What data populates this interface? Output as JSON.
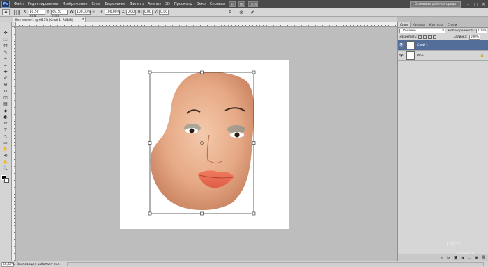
{
  "app": {
    "logo": "Ps",
    "menu": [
      "Файл",
      "Редактирование",
      "Изображение",
      "Слои",
      "Выделение",
      "Фильтр",
      "Анализ",
      "3D",
      "Просмотр",
      "Окно",
      "Справка"
    ],
    "menu_icons": [
      "Br",
      "Mb",
      "100%"
    ],
    "workspace_button": "Основная рабочая среда",
    "window_controls": [
      "–",
      "□",
      "×"
    ]
  },
  "options_bar": {
    "tool_icon": "move-icon",
    "x_label": "X:",
    "x_value": "80,50 mm",
    "y_label": "Y:",
    "y_value": "69,50 mm",
    "w_label": "W:",
    "w_value": "100,00%",
    "h_label": "H:",
    "h_value": "100,00%",
    "angle_label": "∠",
    "angle_value": "0,00",
    "skew_h_label": "H:",
    "skew_h_value": "0,00",
    "skew_v_label": "V:",
    "skew_v_value": "0,00",
    "right_icons": [
      "warp-icon",
      "cancel-icon",
      "commit-icon"
    ]
  },
  "document": {
    "tab_title": "Без имени-1 @ 66,7% (Слой 1, RGB/8)",
    "tab_close": "×",
    "zoom": "66,67%",
    "status": "Экспозиция работает только в"
  },
  "tools": [
    "move-icon",
    "marquee-icon",
    "lasso-icon",
    "quick-select-icon",
    "crop-icon",
    "eyedropper-icon",
    "healing-icon",
    "brush-icon",
    "clone-icon",
    "history-brush-icon",
    "eraser-icon",
    "gradient-icon",
    "blur-icon",
    "dodge-icon",
    "pen-icon",
    "type-icon",
    "path-select-icon",
    "shape-icon",
    "hand-3d-icon",
    "rotate-3d-icon",
    "hand-icon",
    "zoom-icon"
  ],
  "tool_glyphs": [
    "✥",
    "⬚",
    "ᗢ",
    "✎",
    "⌗",
    "✒",
    "✚",
    "✐",
    "⊕",
    "↺",
    "◫",
    "▤",
    "◆",
    "◐",
    "✑",
    "T",
    "↖",
    "▭",
    "✋",
    "⟲",
    "✋",
    "🔍"
  ],
  "layers_panel": {
    "tabs": [
      "Слои",
      "Каналы",
      "Контуры",
      "Стили"
    ],
    "blend_mode": "Обычные",
    "opacity_label": "Непрозрачность:",
    "opacity_value": "100%",
    "lock_label": "Закрепить:",
    "fill_label": "Заливка:",
    "fill_value": "100%",
    "layers": [
      {
        "name": "Слой 1",
        "active": true
      },
      {
        "name": "Фон",
        "active": false
      }
    ],
    "bottom_icons": [
      "link-icon",
      "fx-icon",
      "mask-icon",
      "adjustment-icon",
      "group-icon",
      "new-layer-icon",
      "trash-icon"
    ],
    "bottom_glyphs": [
      "∞",
      "fx",
      "◙",
      "◑",
      "▭",
      "▣",
      "🗑"
    ]
  },
  "watermark": {
    "line1": "Fotо",
    "line2": "Konsalt.ru"
  }
}
